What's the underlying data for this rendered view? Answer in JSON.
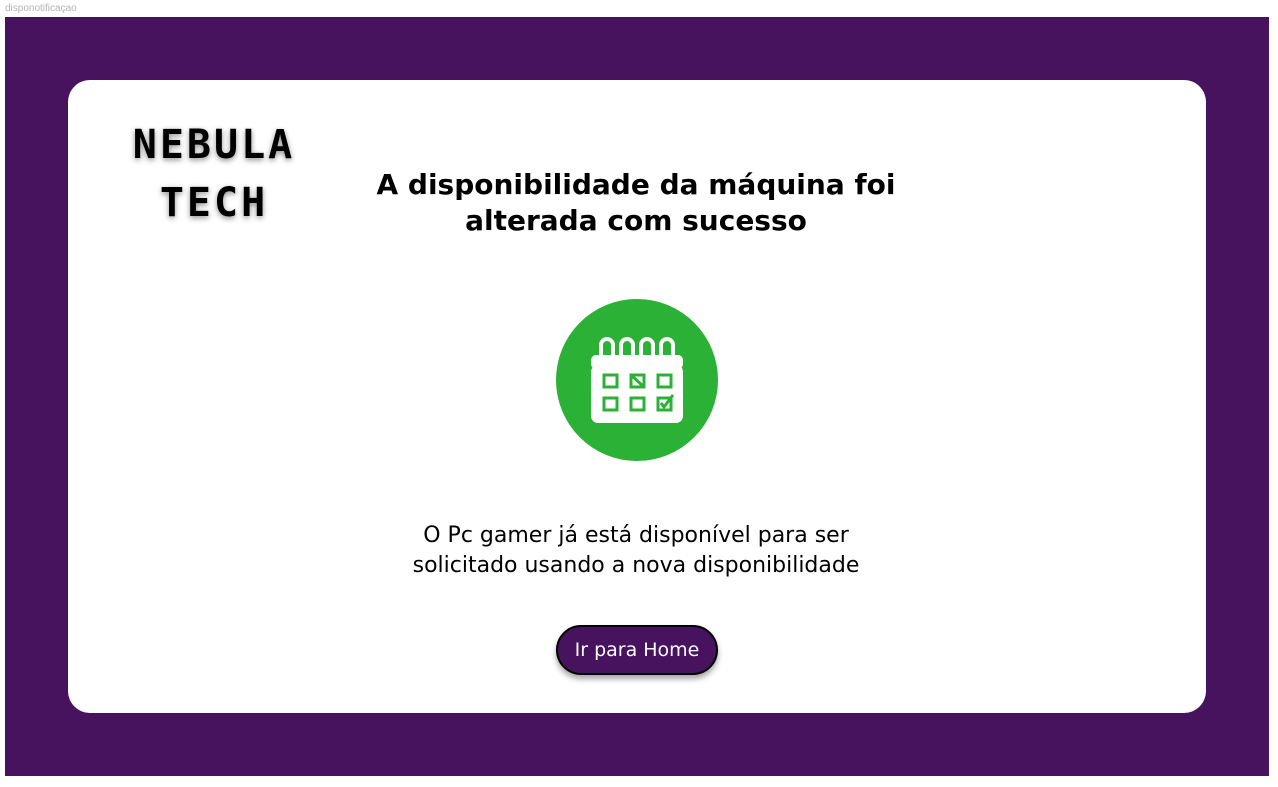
{
  "frame": {
    "label": "disponotificaçao"
  },
  "logo": {
    "line1": "NEBULA",
    "line2": "TECH"
  },
  "title": "A disponibilidade da máquina foi alterada com sucesso",
  "icon": {
    "name": "calendar-check-icon",
    "circle_color": "#2bb135"
  },
  "message": "O Pc gamer já está disponível para ser solicitado usando a nova disponibilidade",
  "button": {
    "label": "Ir para Home",
    "color": "#47125e"
  },
  "colors": {
    "background": "#47125e",
    "card": "#ffffff",
    "accent": "#2bb135"
  }
}
